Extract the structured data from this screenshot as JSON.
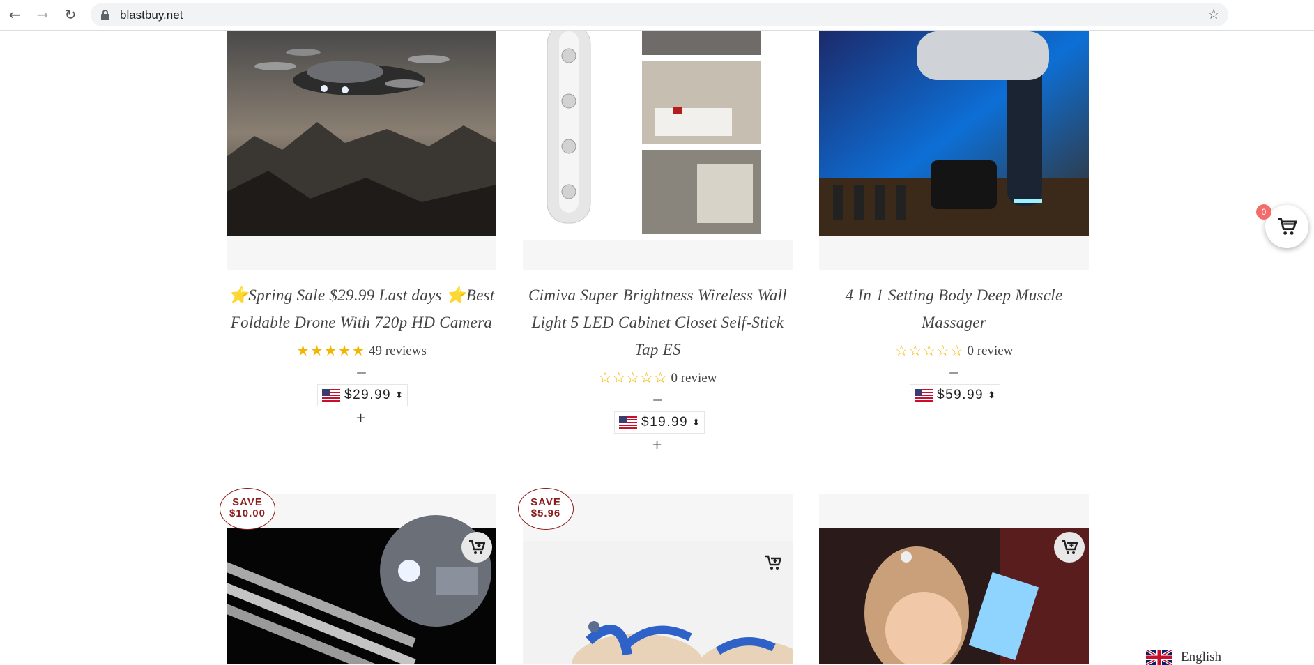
{
  "browser": {
    "url": "blastbuy.net"
  },
  "products_top": [
    {
      "title": "⭐Spring Sale $29.99 Last days ⭐Best Foldable Drone With 720p HD Camera",
      "stars": "★★★★★",
      "reviews": "49 reviews",
      "dash": "—",
      "currency": "$",
      "price": "29.99",
      "rating_value": 5
    },
    {
      "title": "Cimiva Super Brightness Wireless Wall Light 5 LED Cabinet Closet Self-Stick Tap ES",
      "stars": "☆☆☆☆☆",
      "reviews": "0 review",
      "dash": "—",
      "currency": "$",
      "price": "19.99",
      "rating_value": 0
    },
    {
      "title": "4 In 1 Setting Body Deep Muscle Massager",
      "stars": "☆☆☆☆☆",
      "reviews": "0 review",
      "dash": "—",
      "currency": "$",
      "price": "59.99",
      "rating_value": 0
    }
  ],
  "plus_symbol": "+",
  "products_bottom": [
    {
      "save_label": "SAVE",
      "save_amount": "$10.00"
    },
    {
      "save_label": "SAVE",
      "save_amount": "$5.96"
    },
    {}
  ],
  "cart": {
    "count": "0"
  },
  "language": {
    "label": "English"
  },
  "colors": {
    "star": "#f2b600",
    "save": "#8b1c1c",
    "cart_badge": "#f36c6c"
  }
}
